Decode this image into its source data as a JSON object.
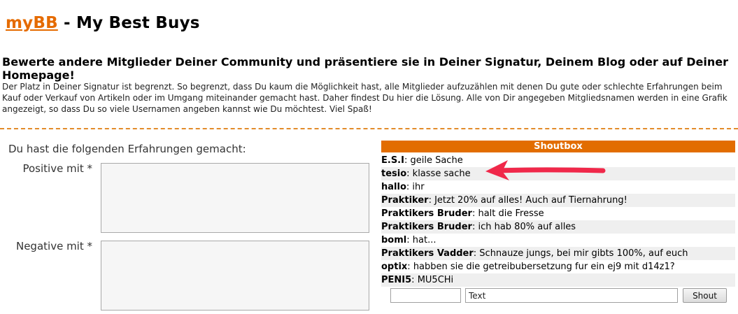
{
  "header": {
    "brand_link": "myBB",
    "title_suffix": "- My Best Buys"
  },
  "intro": {
    "title": "Bewerte andere Mitglieder Deiner Community und präsentiere sie in Deiner Signatur, Deinem Blog oder auf Deiner Homepage!",
    "text": "Der Platz in Deiner Signatur ist begrenzt. So begrenzt, dass Du kaum die Möglichkeit hast, alle Mitglieder aufzuzählen mit denen Du gute oder schlechte Erfahrungen beim Kauf oder Verkauf von Artikeln oder im Umgang miteinander gemacht hast. Daher findest Du hier die Lösung. Alle von Dir angegeben Mitgliedsnamen werden in eine Grafik angezeigt, so dass Du so viele Usernamen angeben kannst wie Du möchtest. Viel Spaß!"
  },
  "experience": {
    "heading": "Du hast die folgenden Erfahrungen gemacht:",
    "positive_label": "Positive mit *",
    "negative_label": "Negative mit *",
    "positive_value": "",
    "negative_value": ""
  },
  "shoutbox": {
    "title": "Shoutbox",
    "messages": [
      {
        "user": "E.S.I",
        "text": "geile Sache"
      },
      {
        "user": "tesio",
        "text": "klasse sache"
      },
      {
        "user": "hallo",
        "text": "ihr"
      },
      {
        "user": "Praktiker",
        "text": "Jetzt 20% auf alles! Auch auf Tiernahrung!"
      },
      {
        "user": "Praktikers Bruder",
        "text": "halt die Fresse"
      },
      {
        "user": "Praktikers Bruder",
        "text": "ich hab 80% auf alles"
      },
      {
        "user": "boml",
        "text": "hat..."
      },
      {
        "user": "Praktikers Vadder",
        "text": "Schnauze jungs, bei mir gibts 100%, auf euch"
      },
      {
        "user": "optix",
        "text": "habben sie die getreibubersetzung fur ein ej9 mit d14z1?"
      },
      {
        "user": "PENI5",
        "text": "MU5CHi"
      }
    ],
    "name_value": "",
    "text_value": "Text",
    "shout_label": "Shout"
  },
  "colors": {
    "brand": "#e56b00",
    "shoutbox_header": "#e26d00",
    "annotation_arrow": "#f0284a"
  }
}
